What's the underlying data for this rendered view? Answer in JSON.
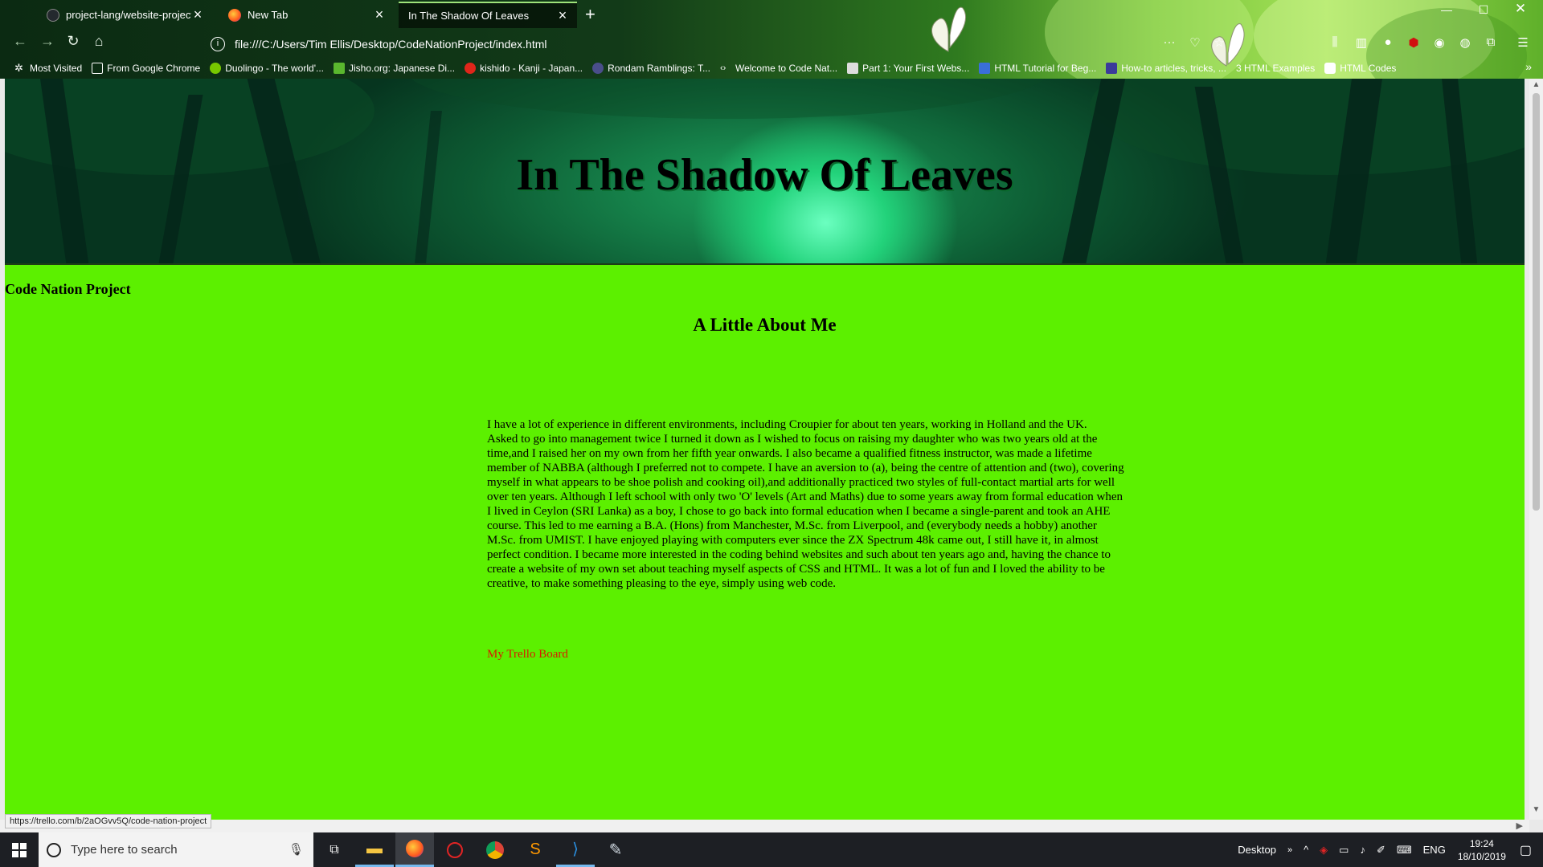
{
  "browser": {
    "tabs": [
      {
        "title": "project-lang/website-project",
        "active": false
      },
      {
        "title": "New Tab",
        "active": false
      },
      {
        "title": "In The Shadow Of Leaves",
        "active": true
      }
    ],
    "url": "file:///C:/Users/Tim Ellis/Desktop/CodeNationProject/index.html",
    "bookmarks": [
      "Most Visited",
      "From Google Chrome",
      "Duolingo - The world'...",
      "Jisho.org: Japanese Di...",
      "kishido - Kanji - Japan...",
      "Rondam Ramblings: T...",
      "Welcome to Code Nat...",
      "Part 1: Your First Webs...",
      "HTML Tutorial for Beg...",
      "How-to articles, tricks, ...",
      "3 HTML Examples",
      "HTML Codes"
    ],
    "status_url": "https://trello.com/b/2aOGvv5Q/code-nation-project"
  },
  "page": {
    "title": "In The Shadow Of Leaves",
    "site_name": "Code Nation Project",
    "section_heading": "A Little About Me",
    "paragraph_1": "I have a lot of experience in different environments, including Croupier for about ten years, working in Holland and the UK.",
    "paragraph_2": "Asked to go into management twice I turned it down as I wished to focus on raising my daughter who was two years old at the time,and I raised her on my own from her fifth year onwards. I also became a qualified fitness instructor, was made a lifetime member of NABBA (although I preferred not to compete. I have an aversion to (a), being the centre of attention and (two), covering myself in what appears to be shoe polish and cooking oil),and additionally practiced two styles of full-contact martial arts for well over ten years. Although I left school with only two 'O' levels (Art and Maths) due to some years away from formal education when I lived in Ceylon (SRI Lanka) as a boy, I chose to go back into formal education when I became a single-parent and took an AHE course. This led to me earning a B.A. (Hons) from Manchester, M.Sc. from Liverpool, and (everybody needs a hobby) another M.Sc. from UMIST. I have enjoyed playing with computers ever since the ZX Spectrum 48k came out, I still have it, in almost perfect condition. I became more interested in the coding behind websites and such about ten years ago and, having the chance to create a website of my own set about teaching myself aspects of CSS and HTML. It was a lot of fun and I loved the ability to be creative, to make something pleasing to the eye, simply using web code.",
    "link_text": "My Trello Board",
    "colors": {
      "background": "#5cf000",
      "link": "#d81b00"
    }
  },
  "taskbar": {
    "search_placeholder": "Type here to search",
    "desktop_label": "Desktop",
    "language": "ENG",
    "time": "19:24",
    "date": "18/10/2019"
  }
}
